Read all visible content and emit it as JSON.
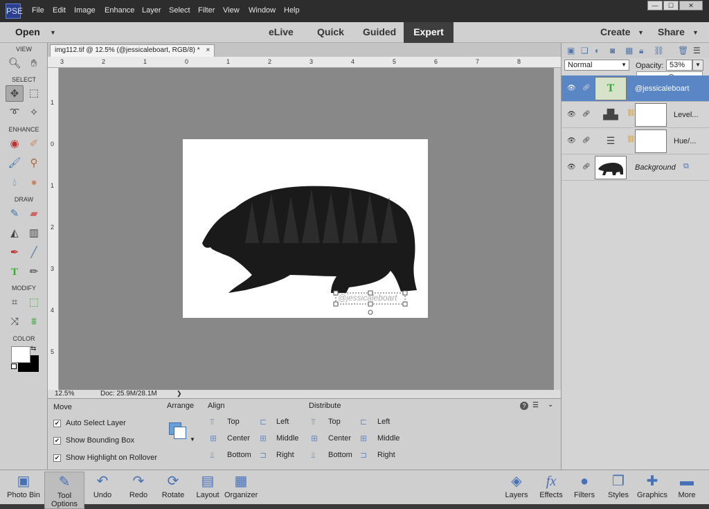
{
  "app": {
    "logo": "PSE"
  },
  "menu": [
    "File",
    "Edit",
    "Image",
    "Enhance",
    "Layer",
    "Select",
    "Filter",
    "View",
    "Window",
    "Help"
  ],
  "window_controls": [
    "—",
    "☐",
    "✕"
  ],
  "modebar": {
    "open": "Open",
    "tabs": [
      "eLive",
      "Quick",
      "Guided",
      "Expert"
    ],
    "create": "Create",
    "share": "Share"
  },
  "toolbox": {
    "sections": [
      "VIEW",
      "SELECT",
      "ENHANCE",
      "DRAW",
      "MODIFY",
      "COLOR"
    ]
  },
  "document": {
    "tab_title": "img112.tif @ 12.5% (@jessicaleboart, RGB/8) *",
    "close": "×",
    "watermark": "@jessicaleboart"
  },
  "ruler_h": [
    "3",
    "2",
    "1",
    "0",
    "1",
    "2",
    "3",
    "4",
    "5",
    "6",
    "7",
    "8"
  ],
  "ruler_v": [
    "1",
    "0",
    "1",
    "2",
    "3",
    "4",
    "5"
  ],
  "status": {
    "zoom": "12.5%",
    "doc": "Doc: 25.9M/28.1M"
  },
  "options": {
    "move_title": "Move",
    "move_checks": [
      "Auto Select Layer",
      "Show Bounding Box",
      "Show Highlight on Rollover"
    ],
    "arrange_title": "Arrange",
    "align_title": "Align",
    "align_items": [
      "Top",
      "Center",
      "Bottom",
      "Left",
      "Middle",
      "Right"
    ],
    "distribute_title": "Distribute",
    "distribute_items": [
      "Top",
      "Center",
      "Bottom",
      "Left",
      "Middle",
      "Right"
    ]
  },
  "layers_panel": {
    "blend_mode": "Normal",
    "opacity_label": "Opacity:",
    "opacity_value": "53%",
    "opacity_fraction": 0.53,
    "layers": [
      {
        "name": "@jessicaleboart",
        "thumb": "T"
      },
      {
        "name": "Level..."
      },
      {
        "name": "Hue/..."
      },
      {
        "name": "Background"
      }
    ]
  },
  "bottombar": {
    "left": [
      {
        "label": "Photo Bin",
        "icon": "▣"
      },
      {
        "label": "Tool Options",
        "icon": "✎"
      },
      {
        "label": "Undo",
        "icon": "↶"
      },
      {
        "label": "Redo",
        "icon": "↷"
      },
      {
        "label": "Rotate",
        "icon": "⟳"
      },
      {
        "label": "Layout",
        "icon": "▤"
      },
      {
        "label": "Organizer",
        "icon": "▦"
      }
    ],
    "right": [
      {
        "label": "Layers",
        "icon": "◈"
      },
      {
        "label": "Effects",
        "icon": "fx"
      },
      {
        "label": "Filters",
        "icon": "●"
      },
      {
        "label": "Styles",
        "icon": "❒"
      },
      {
        "label": "Graphics",
        "icon": "✚"
      },
      {
        "label": "More",
        "icon": "▬"
      }
    ]
  },
  "colors": {
    "accent": "#4670b7",
    "selected_layer": "#5b86c6",
    "canvas_bg": "#888888"
  }
}
